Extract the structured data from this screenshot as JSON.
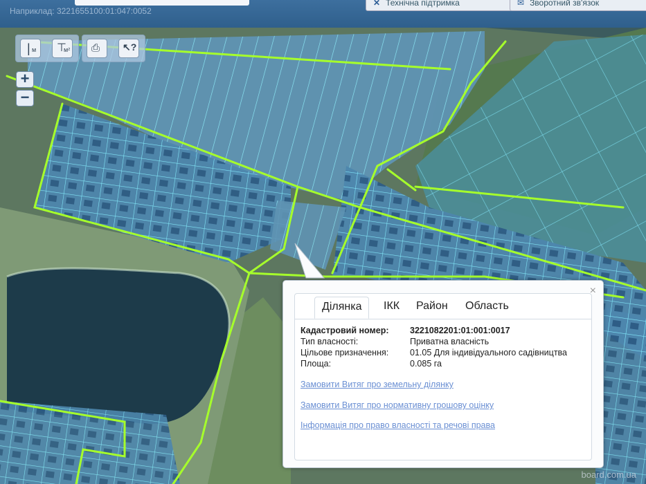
{
  "header": {
    "search_example": "Наприклад: 3221655100:01:047:0052",
    "support_button": "Технічна підтримка",
    "feedback_button": "Зворотний зв'язок"
  },
  "toolbar": {
    "measure_length": "м",
    "measure_area": "м²"
  },
  "zoom": {
    "plus": "+",
    "minus": "−"
  },
  "popup": {
    "tabs": [
      "Ділянка",
      "ІКК",
      "Район",
      "Область"
    ],
    "active_tab": "Ділянка",
    "fields": [
      {
        "label": "Кадастровий номер:",
        "value": "3221082201:01:001:0017"
      },
      {
        "label": "Тип власності:",
        "value": "Приватна власність"
      },
      {
        "label": "Цільове призначення:",
        "value": "01.05 Для індивідуального садівництва"
      },
      {
        "label": "Площа:",
        "value": "0.085 га"
      }
    ],
    "links": [
      "Замовити Витяг про земельну ділянку",
      "Замовити Витяг про нормативну грошову оцінку",
      "Інформація про право власності та речові права"
    ],
    "close": "×"
  },
  "watermark": "board.com.ua",
  "colors": {
    "parcel_stroke": "#6fe3ff",
    "boundary": "#a6ff2b",
    "water": "#1d3b4a"
  }
}
